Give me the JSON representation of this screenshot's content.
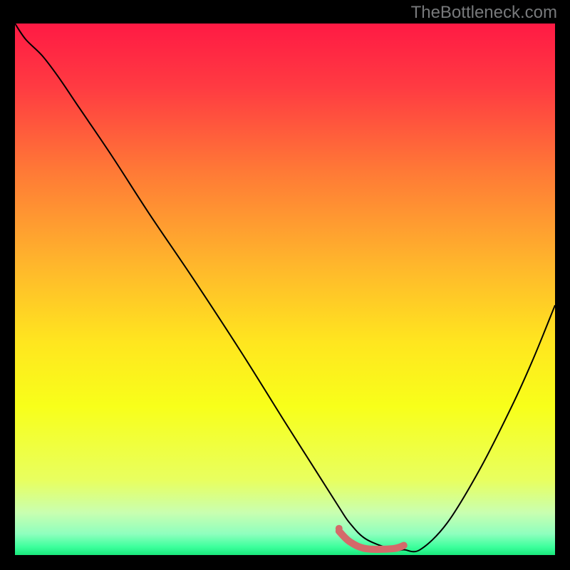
{
  "watermark": "TheBottleneck.com",
  "chart_data": {
    "type": "line",
    "title": "",
    "xlabel": "",
    "ylabel": "",
    "xlim": [
      0,
      100
    ],
    "ylim": [
      0,
      100
    ],
    "background_gradient": {
      "stops": [
        {
          "pos": 0.0,
          "color": "#ff1a44"
        },
        {
          "pos": 0.12,
          "color": "#ff3b42"
        },
        {
          "pos": 0.28,
          "color": "#ff7a36"
        },
        {
          "pos": 0.45,
          "color": "#ffb52c"
        },
        {
          "pos": 0.6,
          "color": "#ffe61f"
        },
        {
          "pos": 0.72,
          "color": "#f8ff1a"
        },
        {
          "pos": 0.86,
          "color": "#e8ff60"
        },
        {
          "pos": 0.92,
          "color": "#c9ffb0"
        },
        {
          "pos": 0.96,
          "color": "#8fffbe"
        },
        {
          "pos": 0.985,
          "color": "#3cff9c"
        },
        {
          "pos": 1.0,
          "color": "#19e87c"
        }
      ]
    },
    "series": [
      {
        "name": "bottleneck-curve",
        "color": "#000000",
        "width": 2,
        "x": [
          0,
          2,
          5,
          8,
          12,
          18,
          25,
          33,
          42,
          50,
          55,
          60,
          62,
          65,
          70,
          72,
          75,
          80,
          86,
          92,
          96,
          100
        ],
        "y": [
          100,
          97,
          94,
          90,
          84,
          75,
          64,
          52,
          38,
          25,
          17,
          9,
          6,
          3,
          1,
          1,
          1,
          6,
          16,
          28,
          37,
          47
        ]
      },
      {
        "name": "optimal-marker",
        "color": "#d46a6a",
        "width": 10,
        "type": "segment",
        "x": [
          60,
          62,
          65,
          70,
          72
        ],
        "y": [
          4.5,
          2.5,
          1.2,
          1.2,
          1.8
        ]
      }
    ],
    "marker_dot": {
      "x": 60,
      "y": 5,
      "r": 5,
      "color": "#d46a6a"
    }
  }
}
